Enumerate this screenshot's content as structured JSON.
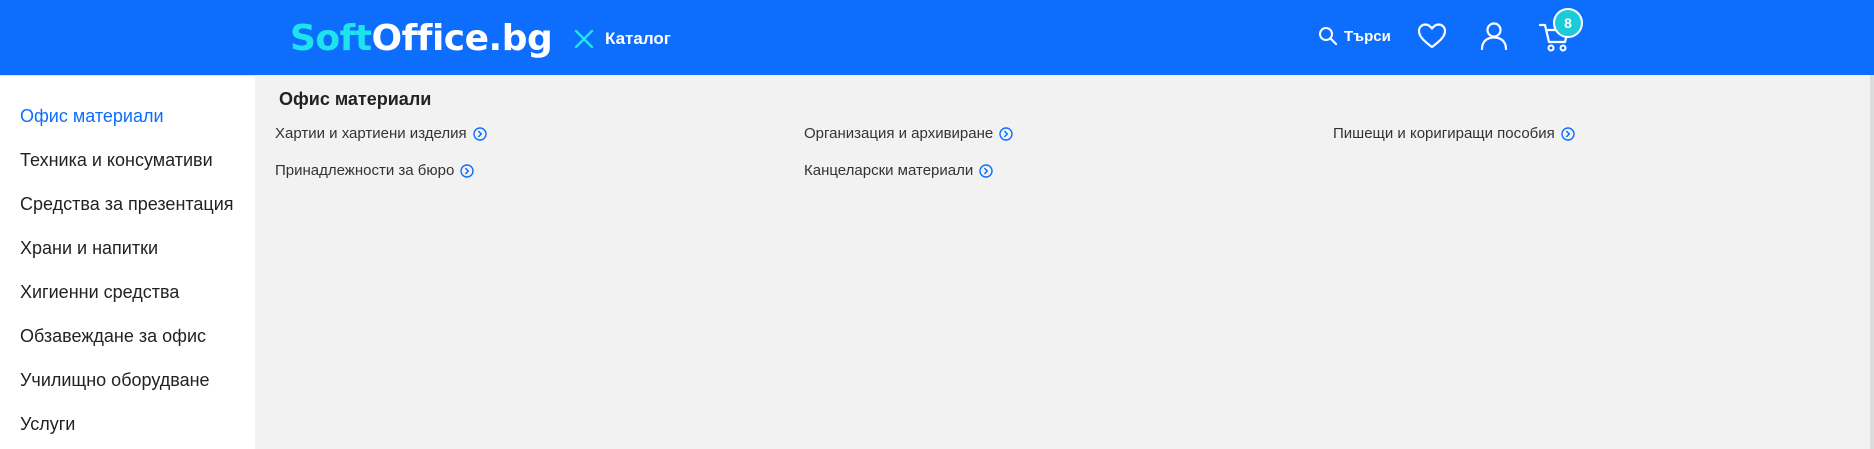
{
  "header": {
    "logo_soft": "Soft",
    "logo_rest": "Office.bg",
    "catalog_label": "Каталог",
    "search_label": "Търси",
    "cart_count": "8",
    "brand_color": "#0d6efd",
    "accent_color": "#1ee3ef"
  },
  "sidebar": {
    "items": [
      {
        "label": "Офис материали",
        "active": true
      },
      {
        "label": "Техника и консумативи"
      },
      {
        "label": "Средства за презентация"
      },
      {
        "label": "Храни и напитки"
      },
      {
        "label": "Хигиенни средства"
      },
      {
        "label": "Обзавеждане за офис"
      },
      {
        "label": "Училищно оборудване"
      },
      {
        "label": "Услуги"
      }
    ]
  },
  "main": {
    "title": "Офис материали",
    "links": [
      "Хартии и хартиени изделия",
      "Организация и архивиране",
      "Пишещи и коригиращи пособия",
      "Принадлежности за бюро",
      "Канцеларски материали"
    ]
  },
  "icons": {
    "catalog": "close-icon",
    "search": "search-icon",
    "favorites": "heart-icon",
    "account": "user-icon",
    "cart": "cart-icon",
    "link_arrow": "chevron-circle-right-icon"
  }
}
